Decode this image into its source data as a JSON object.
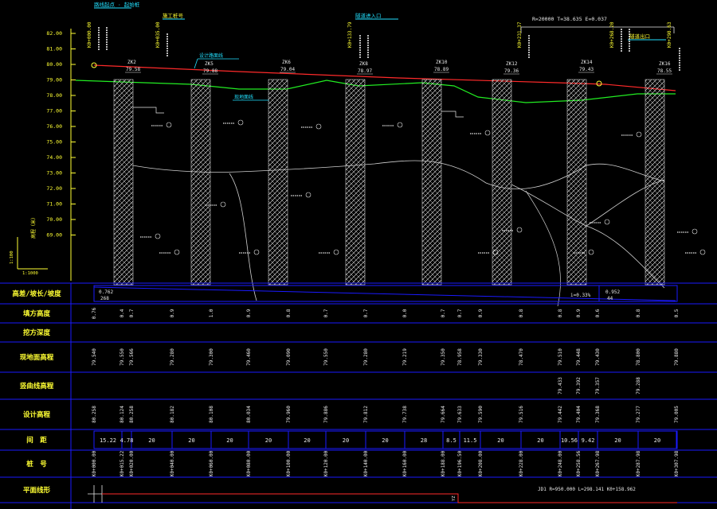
{
  "colors": {
    "background": "#000000",
    "grid_blue": "#1a1aff",
    "design_line": "#ff2a2a",
    "ground_line": "#22ee22",
    "label_yellow": "#ffff33",
    "label_cyan": "#22e0ff",
    "text_white": "#e8e8e8",
    "hatch": "#cfcfcf"
  },
  "top_annotations": {
    "bridge_label": "路线起点 · 起始桩",
    "construction_label": "施工桩号",
    "tunnel_label": "隧道进入口",
    "curve_label": "R=20000  T=38.635  E=0.037",
    "tunnel_exit_label": "隧道出口",
    "design_line_label": "设计路面线",
    "ground_line_label": "现地面线"
  },
  "chainage_marks": [
    "K0+000.00",
    "K0+035.00",
    "K0+133.79",
    "K0+231.37",
    "K0+268.20",
    "K0+298.63"
  ],
  "y_axis": {
    "labels": [
      "82.00",
      "81.00",
      "80.00",
      "79.00",
      "78.00",
      "77.00",
      "76.00",
      "75.00",
      "74.00",
      "73.00",
      "72.00",
      "71.00",
      "70.00",
      "69.00"
    ],
    "vertical_label": "高程（米）",
    "scale_v": "1:100",
    "scale_h": "1:1000"
  },
  "boreholes": [
    {
      "id": "ZK2",
      "elev": "79.58"
    },
    {
      "id": "ZK5",
      "elev": "79.88"
    },
    {
      "id": "ZK6",
      "elev": "79.04"
    },
    {
      "id": "ZK8",
      "elev": "78.97"
    },
    {
      "id": "ZK10",
      "elev": "78.89"
    },
    {
      "id": "ZK12",
      "elev": "79.36"
    },
    {
      "id": "ZK14",
      "elev": "79.43"
    },
    {
      "id": "ZK16",
      "elev": "78.55"
    }
  ],
  "row_labels": [
    "高差/坡长/坡度",
    "填方高度",
    "挖方深度",
    "现地面高程",
    "竖曲线高程",
    "设计高程",
    "间　距",
    "桩　号",
    "平面线形"
  ],
  "slope_row": {
    "left_label": "0.762",
    "left_sub": "268",
    "mid_label": "i=0.33%",
    "right_label": "0.952",
    "right_sub": "44"
  },
  "fill_heights": [
    "0.76",
    "0.4",
    "0.7",
    "0.9",
    "1.0",
    "0.9",
    "0.8",
    "0.7",
    "0.7",
    "0.0",
    "0.7",
    "0.7",
    "0.9",
    "0.8",
    "0.8",
    "0.9",
    "0.6",
    "0.8",
    "0.5"
  ],
  "ground_elev": [
    "79.540",
    "79.550",
    "79.566",
    "79.280",
    "79.300",
    "79.460",
    "79.090",
    "79.550",
    "79.280",
    "79.219",
    "79.350",
    "78.958",
    "79.330",
    "78.470",
    "79.510",
    "79.448",
    "79.430",
    "78.800",
    "79.880"
  ],
  "vc_elev": [
    "79.433",
    "79.392",
    "79.357",
    "79.288"
  ],
  "design_elev": [
    "80.258",
    "80.124",
    "80.258",
    "80.182",
    "80.108",
    "80.034",
    "79.960",
    "79.886",
    "79.812",
    "79.738",
    "79.664",
    "79.633",
    "79.590",
    "79.516",
    "79.442",
    "79.404",
    "79.368",
    "79.277",
    "79.005"
  ],
  "spacing": [
    "15.22",
    "4.78",
    "20",
    "20",
    "20",
    "20",
    "20",
    "20",
    "20",
    "28",
    "8.5",
    "11.5",
    "20",
    "20",
    "10.56",
    "9.42",
    "20",
    "20"
  ],
  "stations": [
    "K0+000.00",
    "K0+015.22",
    "K0+020.00",
    "K0+040.00",
    "K0+060.00",
    "K0+080.00",
    "K0+100.00",
    "K0+120.00",
    "K0+140.00",
    "K0+160.00",
    "K0+188.00",
    "K0+196.50",
    "K0+208.00",
    "K0+228.00",
    "K0+248.00",
    "K0+258.56",
    "K0+267.98",
    "K0+287.98",
    "K0+307.98"
  ],
  "plan_note": "JD1  R=950.000  L=298.141  K0+158.962",
  "plan_point": "YZ"
}
